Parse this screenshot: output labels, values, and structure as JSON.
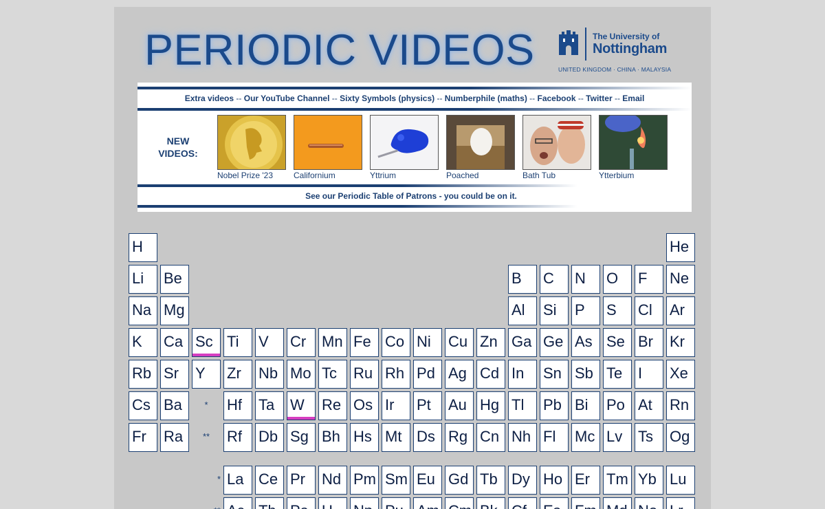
{
  "header": {
    "title": "PERIODIC VIDEOS",
    "university": {
      "line1": "The University of",
      "line2": "Nottingham",
      "campuses": "UNITED KINGDOM · CHINA · MALAYSIA"
    }
  },
  "links": [
    {
      "label": "Extra videos"
    },
    {
      "label": "Our YouTube Channel"
    },
    {
      "label": "Sixty Symbols (physics)"
    },
    {
      "label": "Numberphile (maths)"
    },
    {
      "label": "Facebook"
    },
    {
      "label": "Twitter"
    },
    {
      "label": "Email"
    }
  ],
  "link_separator": "--",
  "new_videos": {
    "label": "NEW VIDEOS:",
    "items": [
      {
        "label": "Nobel Prize '23",
        "icon": "gold-medal-thumbnail"
      },
      {
        "label": "Californium",
        "icon": "orange-sample-thumbnail"
      },
      {
        "label": "Yttrium",
        "icon": "blue-powder-thumbnail"
      },
      {
        "label": "Poached",
        "icon": "egg-in-beaker-thumbnail"
      },
      {
        "label": "Bath Tub",
        "icon": "two-faces-thumbnail"
      },
      {
        "label": "Ytterbium",
        "icon": "flame-test-thumbnail"
      }
    ]
  },
  "patrons": "See our Periodic Table of Patrons - you could be on it.",
  "colors": {
    "accent": "#1b3f72",
    "title": "#1b4a8b",
    "new_marker": "#d63ec0"
  },
  "periodic_table": {
    "main": [
      [
        "H",
        "",
        "",
        "",
        "",
        "",
        "",
        "",
        "",
        "",
        "",
        "",
        "",
        "",
        "",
        "",
        "",
        "He"
      ],
      [
        "Li",
        "Be",
        "",
        "",
        "",
        "",
        "",
        "",
        "",
        "",
        "",
        "",
        "B",
        "C",
        "N",
        "O",
        "F",
        "Ne"
      ],
      [
        "Na",
        "Mg",
        "",
        "",
        "",
        "",
        "",
        "",
        "",
        "",
        "",
        "",
        "Al",
        "Si",
        "P",
        "S",
        "Cl",
        "Ar"
      ],
      [
        "K",
        "Ca",
        "Sc",
        "Ti",
        "V",
        "Cr",
        "Mn",
        "Fe",
        "Co",
        "Ni",
        "Cu",
        "Zn",
        "Ga",
        "Ge",
        "As",
        "Se",
        "Br",
        "Kr"
      ],
      [
        "Rb",
        "Sr",
        "Y",
        "Zr",
        "Nb",
        "Mo",
        "Tc",
        "Ru",
        "Rh",
        "Pd",
        "Ag",
        "Cd",
        "In",
        "Sn",
        "Sb",
        "Te",
        "I",
        "Xe"
      ],
      [
        "Cs",
        "Ba",
        "*",
        "Hf",
        "Ta",
        "W",
        "Re",
        "Os",
        "Ir",
        "Pt",
        "Au",
        "Hg",
        "Tl",
        "Pb",
        "Bi",
        "Po",
        "At",
        "Rn"
      ],
      [
        "Fr",
        "Ra",
        "**",
        "Rf",
        "Db",
        "Sg",
        "Bh",
        "Hs",
        "Mt",
        "Ds",
        "Rg",
        "Cn",
        "Nh",
        "Fl",
        "Mc",
        "Lv",
        "Ts",
        "Og"
      ]
    ],
    "lanthanides": {
      "marker": "*",
      "elements": [
        "La",
        "Ce",
        "Pr",
        "Nd",
        "Pm",
        "Sm",
        "Eu",
        "Gd",
        "Tb",
        "Dy",
        "Ho",
        "Er",
        "Tm",
        "Yb",
        "Lu"
      ]
    },
    "actinides": {
      "marker": "**",
      "elements": [
        "Ac",
        "Th",
        "Pa",
        "U",
        "Np",
        "Pu",
        "Am",
        "Cm",
        "Bk",
        "Cf",
        "Es",
        "Fm",
        "Md",
        "No",
        "Lr"
      ]
    },
    "highlighted": [
      "Sc",
      "W"
    ]
  }
}
